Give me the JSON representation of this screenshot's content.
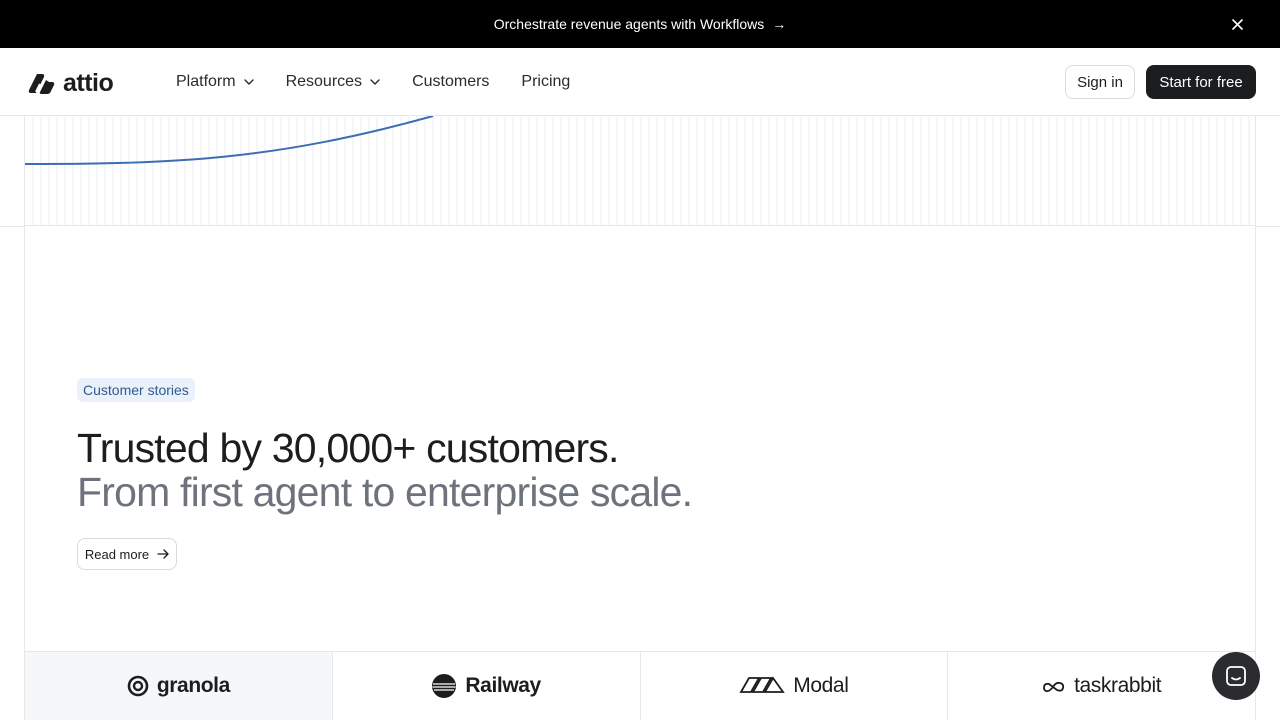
{
  "announcement": {
    "text": "Orchestrate revenue agents with Workflows",
    "arrow": "→",
    "close_icon": "close-icon"
  },
  "nav": {
    "logo_text": "attio",
    "menu": [
      {
        "label": "Platform",
        "has_dropdown": true
      },
      {
        "label": "Resources",
        "has_dropdown": true
      },
      {
        "label": "Customers",
        "has_dropdown": false
      },
      {
        "label": "Pricing",
        "has_dropdown": false
      }
    ],
    "signin_label": "Sign in",
    "start_label": "Start for free"
  },
  "hero": {
    "badge": "Customer stories",
    "headline": "Trusted by 30,000+ customers.",
    "subheadline": "From first agent to enterprise scale.",
    "read_more": "Read more"
  },
  "logos": [
    {
      "name": "granola",
      "icon": "granola-logo-icon"
    },
    {
      "name": "Railway",
      "icon": "railway-logo-icon"
    },
    {
      "name": "Modal",
      "icon": "modal-logo-icon"
    },
    {
      "name": "taskrabbit",
      "icon": "taskrabbit-logo-icon"
    }
  ],
  "colors": {
    "accent_line": "#3d6db3",
    "badge_bg": "#eaf1fb",
    "badge_text": "#2f5b92",
    "dark": "#1c1d1f"
  }
}
